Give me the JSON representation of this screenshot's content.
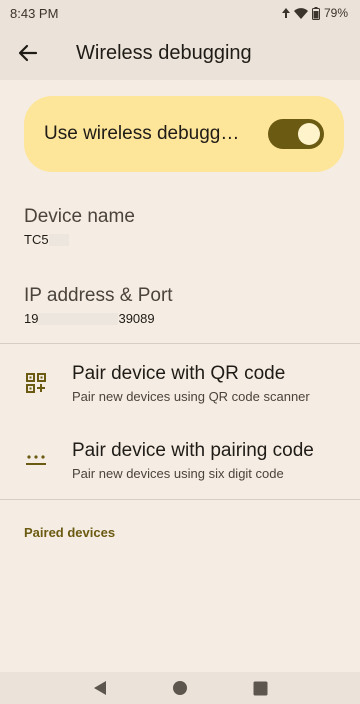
{
  "status_bar": {
    "time": "8:43 PM",
    "battery": "79%",
    "icons": [
      "data-saver-icon",
      "wifi-icon",
      "battery-icon"
    ]
  },
  "app_bar": {
    "title": "Wireless debugging",
    "back_icon": "arrow-back-icon"
  },
  "toggle": {
    "label": "Use wireless debugg…",
    "state": "on",
    "accent": "#6b5a12",
    "card_color": "#fde59a"
  },
  "device_name": {
    "title": "Device name",
    "value": "TC5"
  },
  "ip_port": {
    "title": "IP address & Port",
    "value_prefix": "19",
    "value_suffix": "39089"
  },
  "pair_qr": {
    "title": "Pair device with QR code",
    "subtitle": "Pair new devices using QR code scanner",
    "icon": "qr-code-scanner-icon"
  },
  "pair_code": {
    "title": "Pair device with pairing code",
    "subtitle": "Pair new devices using six digit code",
    "icon": "password-dots-icon"
  },
  "paired_devices": {
    "header": "Paired devices"
  },
  "nav": {
    "icons": [
      "back-triangle-icon",
      "home-circle-icon",
      "recents-square-icon"
    ]
  }
}
